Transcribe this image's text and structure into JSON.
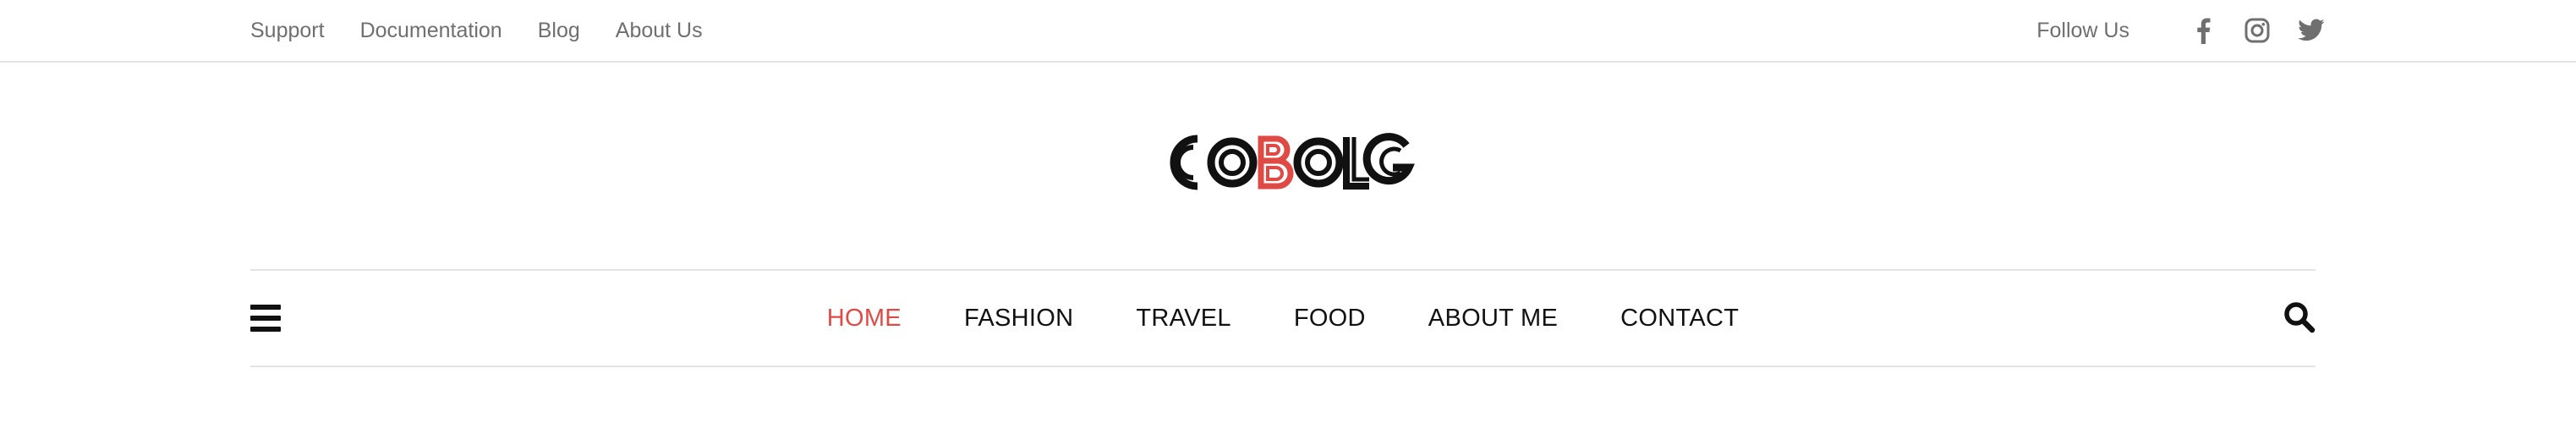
{
  "topbar": {
    "links": [
      "Support",
      "Documentation",
      "Blog",
      "About Us"
    ],
    "follow_label": "Follow Us",
    "social_icons": [
      "facebook-icon",
      "instagram-icon",
      "twitter-icon"
    ]
  },
  "logo": {
    "text": "COBOLG",
    "accent_letter": "B",
    "primary_color": "#111111",
    "accent_color": "#e04a45"
  },
  "nav": {
    "items": [
      "HOME",
      "FASHION",
      "TRAVEL",
      "FOOD",
      "ABOUT ME",
      "CONTACT"
    ],
    "active": "HOME",
    "menu_icon": "hamburger-menu-icon",
    "search_icon": "search-icon"
  },
  "colors": {
    "accent": "#e04a45",
    "text_muted": "#6f6f6f",
    "text_dark": "#111111",
    "divider": "#e3e3e3"
  }
}
